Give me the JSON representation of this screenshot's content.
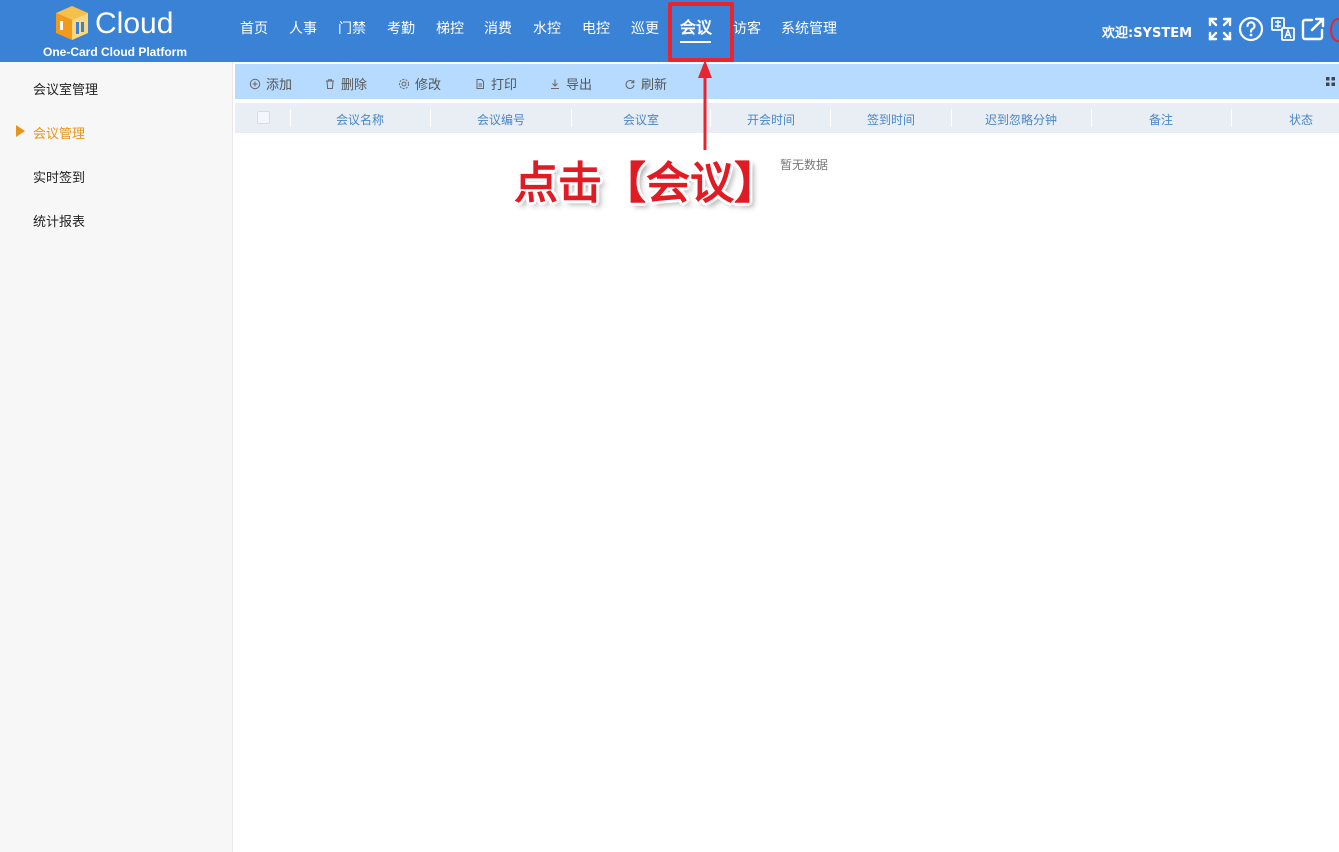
{
  "app": {
    "logo_text": "Cloud",
    "logo_subtitle": "One-Card Cloud Platform",
    "welcome": "欢迎:SYSTEM"
  },
  "nav": {
    "items": [
      "首页",
      "人事",
      "门禁",
      "考勤",
      "梯控",
      "消费",
      "水控",
      "电控",
      "巡更",
      "会议",
      "访客",
      "系统管理"
    ],
    "active": "会议"
  },
  "header_icons": [
    "fullscreen-icon",
    "help-icon",
    "language-icon",
    "external-link-icon"
  ],
  "sidebar": {
    "items": [
      "会议室管理",
      "会议管理",
      "实时签到",
      "统计报表"
    ],
    "active": "会议管理"
  },
  "toolbar": {
    "add": "添加",
    "delete": "删除",
    "edit": "修改",
    "print": "打印",
    "export": "导出",
    "refresh": "刷新"
  },
  "table": {
    "columns": [
      "会议名称",
      "会议编号",
      "会议室",
      "开会时间",
      "签到时间",
      "迟到忽略分钟",
      "备注",
      "状态"
    ],
    "empty_text": "暂无数据"
  },
  "annotation": {
    "text": "点击【会议】"
  },
  "colors": {
    "header_bg": "#3a82d6",
    "toolbar_bg": "#b6dbff",
    "sidebar_active": "#e8941a",
    "annotation_red": "#e8242e"
  }
}
